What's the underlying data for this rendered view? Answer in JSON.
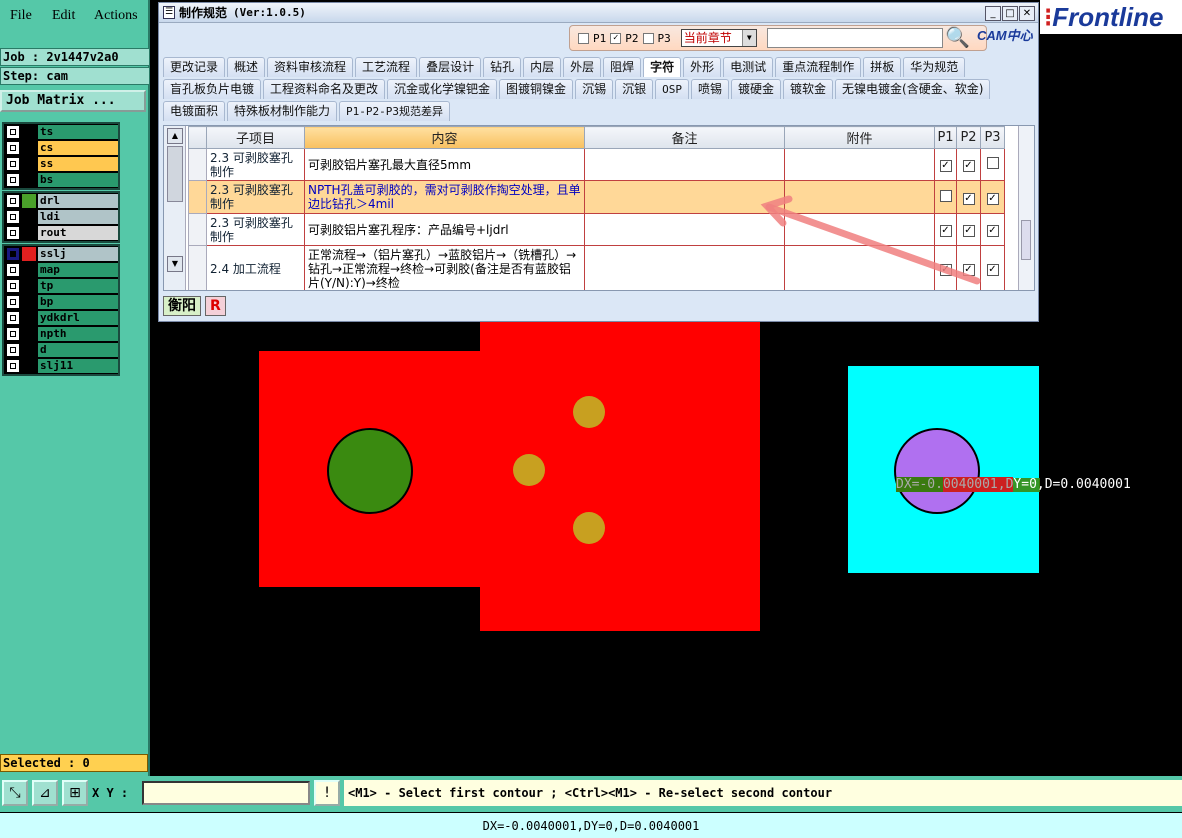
{
  "menubar": {
    "file": "File",
    "edit": "Edit",
    "actions": "Actions"
  },
  "job": {
    "job_label": "Job : 2v1447v2a0",
    "step_label": "Step: cam",
    "matrix_button": "Job Matrix ..."
  },
  "layers": {
    "group1": [
      {
        "name": "ts",
        "color": "#2a9a6e"
      },
      {
        "name": "cs",
        "color": "#ffc850"
      },
      {
        "name": "ss",
        "color": "#ffc850"
      },
      {
        "name": "bs",
        "color": "#2a9a6e"
      }
    ],
    "group2": [
      {
        "name": "drl",
        "color": "#b0c4c8",
        "swatch": "#4aa02a"
      },
      {
        "name": "ldi",
        "color": "#b0c4c8"
      },
      {
        "name": "rout",
        "color": "#d8d8d8"
      }
    ],
    "group3": [
      {
        "name": "sslj",
        "color": "#b0c4c8",
        "swatch": "#e02020",
        "active": true
      },
      {
        "name": "map",
        "color": "#2a9a6e"
      },
      {
        "name": "tp",
        "color": "#2a9a6e"
      },
      {
        "name": "bp",
        "color": "#2a9a6e"
      },
      {
        "name": "ydkdrl",
        "color": "#2a9a6e"
      },
      {
        "name": "npth",
        "color": "#2a9a6e"
      },
      {
        "name": "d",
        "color": "#2a9a6e"
      },
      {
        "name": "slj11",
        "color": "#2a9a6e"
      }
    ]
  },
  "selected": "Selected : 0",
  "bottom": {
    "xy_label": "X Y :",
    "prompt": "<M1> - Select first contour ; <Ctrl><M1> - Re-select second contour",
    "status": "DX=-0.0040001,DY=0,D=0.0040001"
  },
  "canvas": {
    "measure_text": "DX=-0.0040001,DY=0,D=0.0040001"
  },
  "logo": {
    "text": "Frontline"
  },
  "dialog": {
    "title": "制作规范",
    "version": "(Ver:1.0.5)",
    "filters": {
      "p1": "P1",
      "p2": "P2",
      "p3": "P3",
      "chapter": "当前章节"
    },
    "cam_logo": "CAM中心",
    "tabs_row1": [
      "更改记录",
      "概述",
      "资料审核流程",
      "工艺流程",
      "叠层设计",
      "钻孔",
      "内层",
      "外层",
      "阻焊",
      "字符",
      "外形",
      "电测试",
      "重点流程制作",
      "拼板",
      "华为规范"
    ],
    "tabs_row2": [
      "盲孔板负片电镀",
      "工程资料命名及更改",
      "沉金或化学镍钯金",
      "图镀铜镍金",
      "沉锡",
      "沉银",
      "OSP",
      "喷锡",
      "镀硬金",
      "镀软金",
      "无镍电镀金(含硬金、软金)"
    ],
    "tabs_row3": [
      "电镀面积",
      "特殊板材制作能力",
      "P1-P2-P3规范差异"
    ],
    "active_tab": "字符",
    "columns": [
      "子项目",
      "内容",
      "备注",
      "附件",
      "P1",
      "P2",
      "P3"
    ],
    "rows": [
      {
        "sub": "2.3 可剥胶塞孔制作",
        "content": "可剥胶铝片塞孔最大直径5mm",
        "p1": true,
        "p2": true,
        "p3": false
      },
      {
        "sub": "2.3 可剥胶塞孔制作",
        "content": "NPTH孔盖可剥胶的，需对可剥胶作掏空处理，且单边比钻孔＞4mil",
        "p1": false,
        "p2": true,
        "p3": true,
        "selected": true
      },
      {
        "sub": "2.3 可剥胶塞孔制作",
        "content": "可剥胶铝片塞孔程序：产品编号+ljdrl",
        "p1": true,
        "p2": true,
        "p3": true
      },
      {
        "sub": "2.4 加工流程",
        "content": "正常流程→（铝片塞孔）→蓝胶铝片→（铣槽孔）→钻孔→正常流程→终检→可剥胶(备注是否有蓝胶铝片(Y/N):Y)→终检",
        "p1": true,
        "p2": true,
        "p3": true
      }
    ],
    "footer": {
      "site": "衡阳",
      "r": "R"
    }
  }
}
